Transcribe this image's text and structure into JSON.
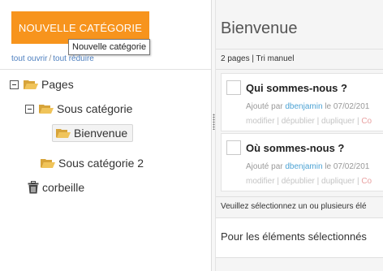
{
  "left": {
    "new_category_button": "NOUVELLE CATÉGORIE",
    "tooltip": "Nouvelle catégorie",
    "open_all": "tout ouvrir",
    "separator": "/",
    "collapse_all": "tout réduire",
    "tree": {
      "root": "Pages",
      "child1": "Sous catégorie",
      "child1_page": "Bienvenue",
      "child2": "Sous catégorie 2",
      "trash": "corbeille"
    }
  },
  "right": {
    "title": "Bienvenue",
    "count_text": "2 pages | Tri manuel",
    "cards": [
      {
        "title": "Qui sommes-nous ?",
        "meta_prefix": "Ajouté par",
        "author": "dbenjamin",
        "meta_suffix": "le 07/02/201",
        "actions": "modifier | dépublier | dupliquer |",
        "action_last": "Co"
      },
      {
        "title": "Où sommes-nous ?",
        "meta_prefix": "Ajouté par",
        "author": "dbenjamin",
        "meta_suffix": "le 07/02/201",
        "actions": "modifier | dépublier | dupliquer |",
        "action_last": "Co"
      }
    ],
    "notice": "Veuillez sélectionnez un ou plusieurs élé",
    "bulk_label": "Pour les éléments sélectionnés"
  },
  "colors": {
    "accent": "#f7941d",
    "folder": "#e8b64c",
    "link": "#4d7fbf",
    "author": "#4da3d4"
  },
  "icons": [
    "minus-toggle-icon",
    "folder-icon",
    "trash-icon",
    "grip-icon",
    "checkbox-icon"
  ]
}
